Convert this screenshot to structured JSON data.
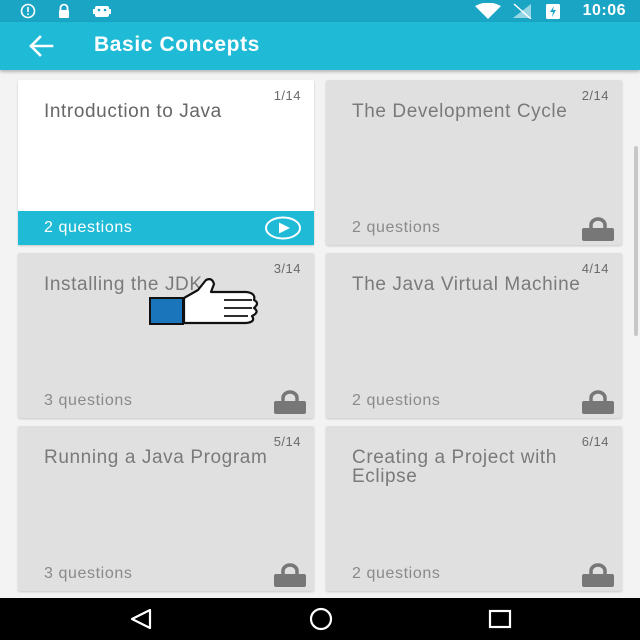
{
  "status_bar": {
    "time": "10:06",
    "icons": [
      "alert-icon",
      "lock-icon",
      "android-icon",
      "wifi-icon",
      "signal-icon",
      "battery-icon"
    ]
  },
  "app_bar": {
    "title": "Basic Concepts",
    "back_icon": "arrow-left-icon"
  },
  "lessons": [
    {
      "title": "Introduction to Java",
      "number": "1/14",
      "questions": "2 questions",
      "state": "unlocked",
      "action_icon": "play-icon"
    },
    {
      "title": "The Development Cycle",
      "number": "2/14",
      "questions": "2 questions",
      "state": "locked",
      "action_icon": "lock-icon"
    },
    {
      "title": "Installing the JDK",
      "number": "3/14",
      "questions": "3 questions",
      "state": "locked",
      "action_icon": "lock-icon"
    },
    {
      "title": "The Java Virtual Machine",
      "number": "4/14",
      "questions": "2 questions",
      "state": "locked",
      "action_icon": "lock-icon"
    },
    {
      "title": "Running a Java Program",
      "number": "5/14",
      "questions": "3 questions",
      "state": "locked",
      "action_icon": "lock-icon"
    },
    {
      "title": "Creating a Project with Eclipse",
      "number": "6/14",
      "questions": "2 questions",
      "state": "locked",
      "action_icon": "lock-icon"
    }
  ],
  "overlay": {
    "icon": "thumbs-up-icon"
  },
  "nav_bar": {
    "buttons": [
      "back-triangle-icon",
      "home-circle-icon",
      "recents-square-icon"
    ]
  },
  "colors": {
    "status_bar": "#1aa5c4",
    "app_bar": "#1fbad6",
    "card_locked": "#e0e0e0",
    "card_active": "#ffffff",
    "nav_bar": "#000000"
  }
}
